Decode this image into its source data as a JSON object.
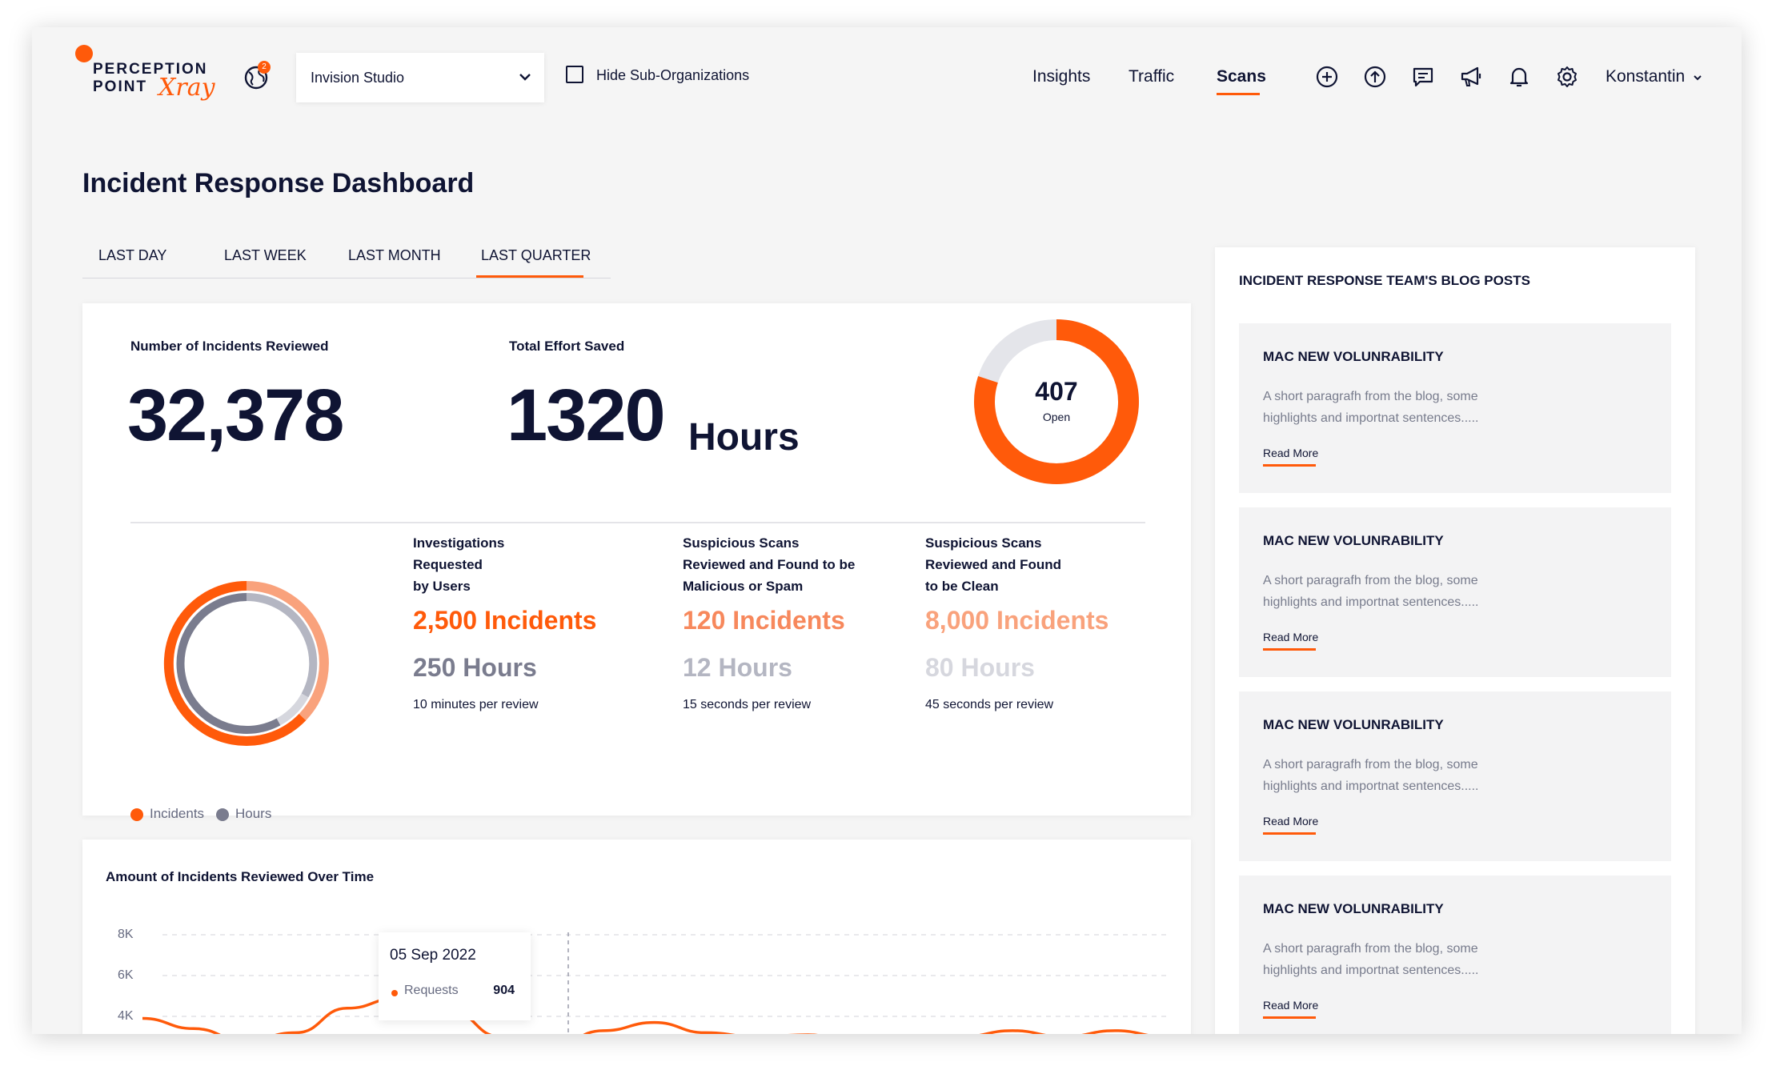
{
  "colors": {
    "accent": "#ff5a0a",
    "accent_light": "#f7885c",
    "accent_lighter": "#f9a27c",
    "navy": "#0f1433",
    "gray": "#7a7c8e",
    "gray_light": "#b4b6c2",
    "gray_lighter": "#d6d7de"
  },
  "header": {
    "logo": {
      "line1": "PERCEPTION",
      "line2": "POINT",
      "script": "Xray"
    },
    "globe_badge": "2",
    "org_select": {
      "value": "Invision Studio"
    },
    "hide_sub_orgs": {
      "label": "Hide Sub-Organizations",
      "checked": false
    },
    "nav": [
      {
        "label": "Insights",
        "active": false
      },
      {
        "label": "Traffic",
        "active": false
      },
      {
        "label": "Scans",
        "active": true
      }
    ],
    "icons": [
      "plus-circle-icon",
      "upload-icon",
      "message-icon",
      "megaphone-icon",
      "bell-icon",
      "gear-icon"
    ],
    "user": "Konstantin"
  },
  "page": {
    "title": "Incident Response Dashboard",
    "tabs": [
      {
        "label": "LAST DAY",
        "active": false
      },
      {
        "label": "LAST WEEK",
        "active": false
      },
      {
        "label": "LAST MONTH",
        "active": false
      },
      {
        "label": "LAST QUARTER",
        "active": true
      }
    ]
  },
  "stats": {
    "incidents_reviewed": {
      "label": "Number of Incidents Reviewed",
      "value": "32,378"
    },
    "effort_saved": {
      "label": "Total Effort Saved",
      "value": "1320",
      "unit": "Hours"
    },
    "open": {
      "value": "407",
      "label": "Open",
      "fraction": 0.8
    },
    "columns": [
      {
        "heading": "Investigations Requested by Users",
        "incidents": "2,500 Incidents",
        "hours": "250 Hours",
        "per": "10 minutes per review"
      },
      {
        "heading": "Suspicious Scans Reviewed and Found to be Malicious or Spam",
        "incidents": "120 Incidents",
        "hours": "12 Hours",
        "per": "15 seconds per review"
      },
      {
        "heading": "Suspicious Scans Reviewed and Found to be Clean",
        "incidents": "8,000 Incidents",
        "hours": "80 Hours",
        "per": "45 seconds per review"
      }
    ],
    "legend": [
      {
        "label": "Incidents",
        "color": "#ff5a0a"
      },
      {
        "label": "Hours",
        "color": "#7a7c8e"
      }
    ]
  },
  "chart": {
    "title": "Amount of Incidents Reviewed Over Time",
    "ticks": [
      "8K",
      "6K",
      "4K"
    ],
    "tooltip": {
      "date": "05 Sep 2022",
      "series": "Requests",
      "value": "904"
    }
  },
  "chart_data": {
    "type": "line",
    "title": "Amount of Incidents Reviewed Over Time",
    "xlabel": "",
    "ylabel": "",
    "yticks": [
      "8K",
      "6K",
      "4K"
    ],
    "ylim": [
      0,
      8000
    ],
    "grid": true,
    "series": [
      {
        "name": "Requests",
        "x": [
          0,
          1,
          2,
          3,
          4,
          5,
          6,
          7,
          8,
          9,
          10,
          11,
          12,
          13,
          14,
          15,
          16,
          17,
          18,
          19,
          20
        ],
        "values": [
          3900,
          3400,
          2800,
          3200,
          4400,
          4900,
          4300,
          3000,
          2500,
          3300,
          3700,
          3200,
          3000,
          3100,
          2600,
          2700,
          3000,
          3300,
          3000,
          3300,
          3000
        ]
      }
    ],
    "highlight": {
      "date": "05 Sep 2022",
      "series": "Requests",
      "value": 904
    }
  },
  "blog": {
    "title": "INCIDENT RESPONSE TEAM'S BLOG POSTS",
    "posts": [
      {
        "title": "MAC NEW VOLUNRABILITY",
        "text": "A short paragrafh from the blog, some highlights and importnat sentences.....",
        "more": "Read More"
      },
      {
        "title": "MAC NEW VOLUNRABILITY",
        "text": "A short paragrafh from the blog, some highlights and importnat sentences.....",
        "more": "Read More"
      },
      {
        "title": "MAC NEW VOLUNRABILITY",
        "text": "A short paragrafh from the blog, some highlights and importnat sentences.....",
        "more": "Read More"
      },
      {
        "title": "MAC NEW VOLUNRABILITY",
        "text": "A short paragrafh from the blog, some highlights and importnat sentences.....",
        "more": "Read More"
      }
    ]
  }
}
